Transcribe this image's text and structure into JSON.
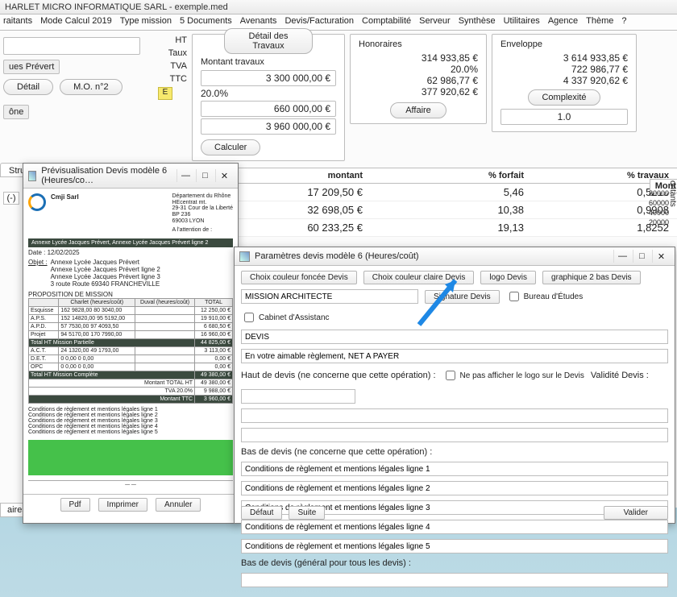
{
  "window": {
    "title": "HARLET MICRO INFORMATIQUE SARL - exemple.med"
  },
  "menu": [
    "raitants",
    "Mode Calcul 2019",
    "Type mission",
    "5 Documents",
    "Avenants",
    "Devis/Facturation",
    "Comptabilité",
    "Serveur",
    "Synthèse",
    "Utilitaires",
    "Agence",
    "Thème",
    "?"
  ],
  "left": {
    "project": "ues Prévert",
    "detail": "Détail",
    "mo": "M.O. n°2",
    "zone": "ône",
    "stru": "Stru",
    "minus": "(-)",
    "aires": "aires"
  },
  "rowlabels": {
    "ht": "HT",
    "taux": "Taux",
    "tva": "TVA",
    "ttc": "TTC",
    "e": "E"
  },
  "travaux": {
    "title": "Détail des Travaux",
    "label": "Montant travaux",
    "ht": "3 300 000,00 €",
    "taux": "20.0%",
    "tva": "660 000,00 €",
    "ttc": "3 960 000,00 €",
    "calc": "Calculer"
  },
  "hono": {
    "title": "Honoraires",
    "ht": "314 933,85 €",
    "taux": "20.0%",
    "tva": "62 986,77 €",
    "ttc": "377 920,62 €",
    "affaire": "Affaire"
  },
  "env": {
    "title": "Enveloppe",
    "ht": "3 614 933,85 €",
    "taux": "722 986,77 €",
    "tva": "4 337 920,62 €",
    "complex": "Complexité",
    "val": "1.0"
  },
  "table": {
    "headers": [
      "montant",
      "% forfait",
      "% travaux"
    ],
    "rows": [
      {
        "m": "17 209,50 €",
        "f": "5,46",
        "t": "0,5215"
      },
      {
        "m": "32 698,05 €",
        "f": "10,38",
        "t": "0,9908"
      },
      {
        "m": "60 233,25 €",
        "f": "19,13",
        "t": "1,8252"
      }
    ],
    "r_title": "Mont",
    "axis": "ontants",
    "ticks": [
      "80000",
      "60000",
      "40000",
      "20000"
    ]
  },
  "preview": {
    "title": "Prévisualisation Devis modèle 6 (Heures/co…",
    "company": "Cmji Sarl",
    "addr": [
      "Département du Rhône",
      "HEcentrat mt.",
      "29-31 Cour de la Liberté",
      "BP 236",
      "69003 LYON"
    ],
    "dest": "A l'attention de :",
    "bar": "Annexe Lycée Jacques Prévert, Annexe Lycée Jacques Prévert ligne 2",
    "date": "Date : 12/02/2025",
    "objet_l": "Objet :",
    "objet": [
      "Annexe Lycée Jacques Prévert",
      "Annexe Lycée Jacques Prévert ligne 2",
      "Annexe Lycée Jacques Prévert ligne 3",
      "3 route Route 69340 FRANCHEVILLE"
    ],
    "prop": "PROPOSITION DE MISSION",
    "th": [
      "",
      "Charlet (heures/coût)",
      "Duval (heures/coût)",
      "TOTAL"
    ],
    "rows": [
      [
        "Esquisse",
        "162  9828,00 80  3040,00",
        "",
        "12 250,00 €"
      ],
      [
        "A.P.S.",
        "152 14820,00 95  5192,00",
        "",
        "19 910,00 €"
      ],
      [
        "A.P.D.",
        "57  7530,00 97  4093,50",
        "",
        "6 680,50 €"
      ],
      [
        "Projet",
        "94  5170,00 170  7990,00",
        "",
        "16 960,00 €"
      ],
      [
        "Total HT Mission Partielle",
        "",
        "",
        "44 825,00 €"
      ],
      [
        "A.C.T.",
        "24  1320,00 49  1793,00",
        "",
        "3 113,00 €"
      ],
      [
        "D.E.T.",
        "0     0,00  0     0,00",
        "",
        "0,00 €"
      ],
      [
        "OPC",
        "0     0,00  0     0,00",
        "",
        "0,00 €"
      ],
      [
        "Total HT Mission Complète",
        "",
        "",
        "49 380,00 €"
      ]
    ],
    "tot1": "Montant TOTAL HT",
    "tot1v": "49 380,00 €",
    "tot2": "TVA 20.0%",
    "tot2v": "9 988,00 €",
    "tot3": "Montant TTC",
    "tot3v": "3 960,00 €",
    "cond": "Conditions de règlement et mentions légales ligne",
    "pdf": "Pdf",
    "print": "Imprimer",
    "cancel": "Annuler"
  },
  "params": {
    "title": "Paramètres devis modèle 6 (Heures/coût)",
    "btns": [
      "Choix couleur foncée Devis",
      "Choix couleur claire Devis",
      "logo Devis",
      "graphique 2 bas Devis"
    ],
    "sig": "Signature Devis",
    "bureau": "Bureau d'Études",
    "cabinet": "Cabinet d'Assistanc",
    "mission": "MISSION ARCHITECTE",
    "devis": "DEVIS",
    "reg": "En votre aimable règlement, NET A PAYER",
    "haut": "Haut de devis  (ne concerne que cette opération) :",
    "noshow": "Ne pas afficher le logo sur le Devis",
    "valid": "Validité Devis :",
    "bas1": "Bas de devis  (ne concerne que cette opération) :",
    "lines": [
      "Conditions de règlement et mentions légales ligne 1",
      "Conditions de règlement et mentions légales ligne 2",
      "Conditions de règlement et mentions légales ligne 3",
      "Conditions de règlement et mentions légales ligne 4",
      "Conditions de règlement et mentions légales ligne 5"
    ],
    "bas2": "Bas de devis  (général pour tous les devis) :",
    "defaut": "Défaut",
    "suite": "Suite",
    "valider": "Valider"
  }
}
